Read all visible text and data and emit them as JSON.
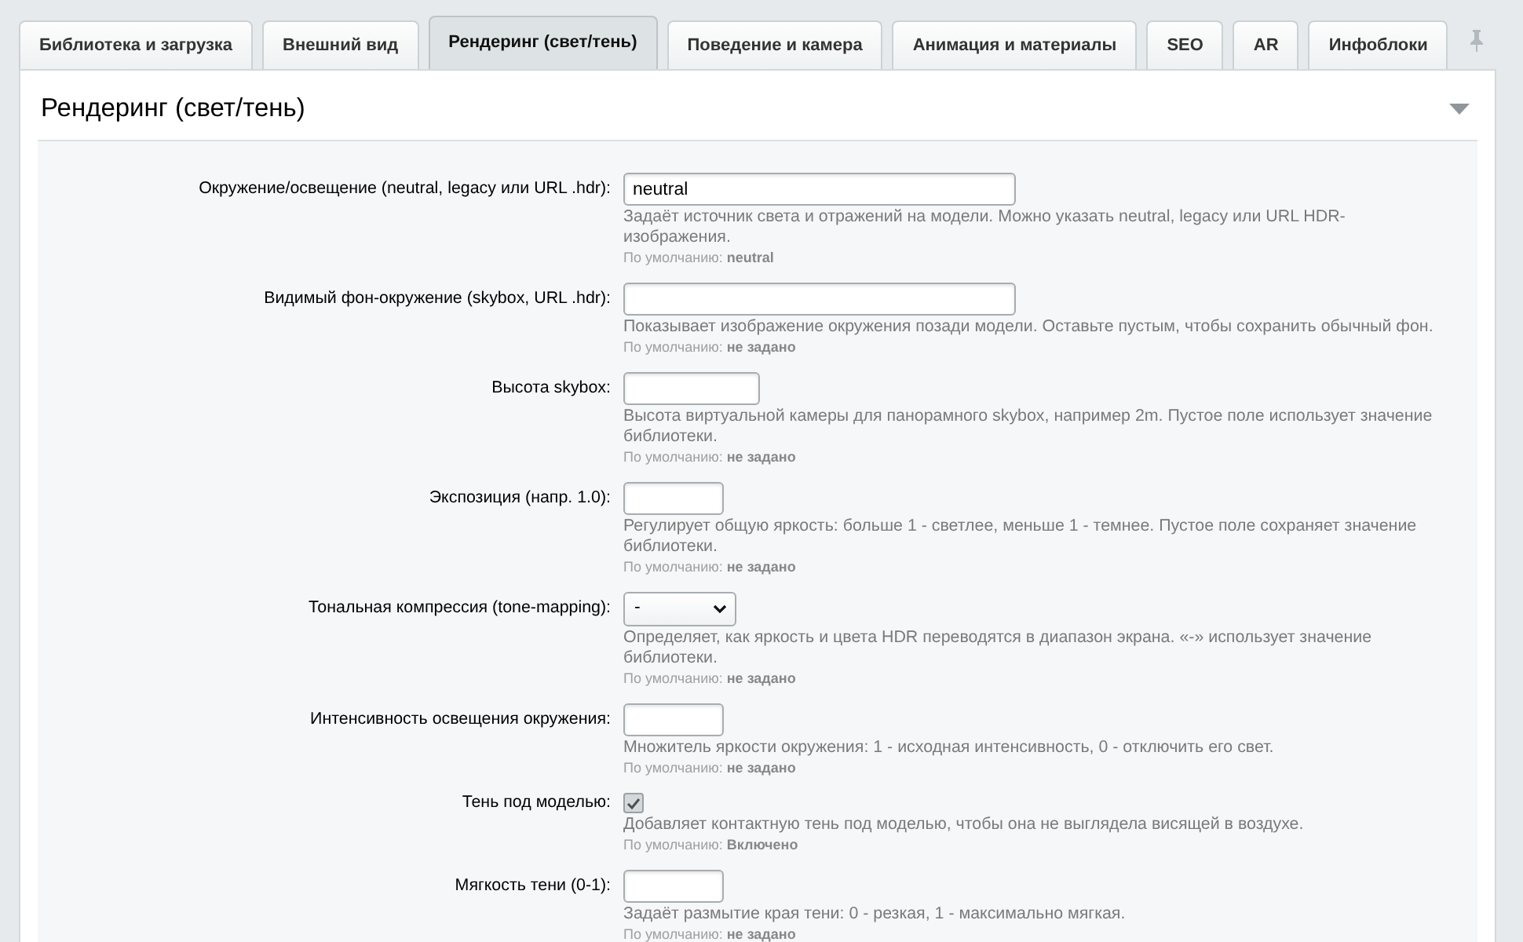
{
  "tabs": [
    {
      "label": "Библиотека и загрузка",
      "selected": false
    },
    {
      "label": "Внешний вид",
      "selected": false
    },
    {
      "label": "Рендеринг (свет/тень)",
      "selected": true
    },
    {
      "label": "Поведение и камера",
      "selected": false
    },
    {
      "label": "Анимация и материалы",
      "selected": false
    },
    {
      "label": "SEO",
      "selected": false
    },
    {
      "label": "AR",
      "selected": false
    },
    {
      "label": "Инфоблоки",
      "selected": false
    }
  ],
  "section": {
    "title": "Рендеринг (свет/тень)",
    "expanded": true
  },
  "fields": [
    {
      "kind": "text",
      "label": "Окружение/освещение (neutral, legacy или URL .hdr):",
      "value": "neutral",
      "help": "Задаёт источник света и отражений на модели. Можно указать neutral, legacy или URL HDR-изображения.",
      "default_note": "По умолчанию: **neutral**"
    },
    {
      "kind": "text",
      "label": "Видимый фон-окружение (skybox, URL .hdr):",
      "help": "Показывает изображение окружения позади модели. Оставьте пустым, чтобы сохранить обычный фон.",
      "default_note": "По умолчанию: **не задано**"
    },
    {
      "kind": "length",
      "label": "Высота skybox:",
      "help": "Высота виртуальной камеры для панорамного skybox, например 2m. Пустое поле использует значение библиотеки.",
      "default_note": "По умолчанию: **не задано**"
    },
    {
      "kind": "number",
      "label": "Экспозиция (напр. 1.0):",
      "help": "Регулирует общую яркость: больше 1 - светлее, меньше 1 - темнее. Пустое поле сохраняет значение библиотеки.",
      "default_note": "По умолчанию: **не задано**"
    },
    {
      "kind": "select",
      "label": "Тональная компрессия (tone-mapping):",
      "value": "-",
      "help": "Определяет, как яркость и цвета HDR переводятся в диапазон экрана. «-» использует значение библиотеки.",
      "default_note": "По умолчанию: **не задано**"
    },
    {
      "kind": "number",
      "label": "Интенсивность освещения окружения:",
      "help": "Множитель яркости окружения: 1 - исходная интенсивность, 0 - отключить его свет.",
      "default_note": "По умолчанию: **не задано**"
    },
    {
      "kind": "checkbox",
      "label": "Тень под моделью:",
      "checked": true,
      "help": "Добавляет контактную тень под моделью, чтобы она не выглядела висящей в воздухе.",
      "default_note": "По умолчанию: **Включено**"
    },
    {
      "kind": "number",
      "label": "Мягкость тени (0-1):",
      "help": "Задаёт размытие края тени: 0 - резкая, 1 - максимально мягкая.",
      "default_note": "По умолчанию: **не задано**"
    }
  ]
}
